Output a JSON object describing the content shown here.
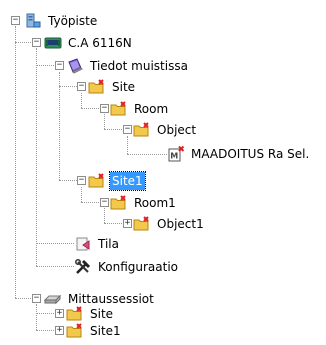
{
  "tree": {
    "root": {
      "label": "Työpiste",
      "icon": "computer-icon",
      "expanded": true
    },
    "instrument": {
      "label": "C.A 6116N",
      "icon": "instrument-icon",
      "expanded": true
    },
    "memory": {
      "label": "Tiedot muistissa",
      "icon": "memory-book-icon",
      "expanded": true
    },
    "mem_site": {
      "label": "Site",
      "icon": "folder-error-icon",
      "expanded": true
    },
    "mem_room": {
      "label": "Room",
      "icon": "folder-error-icon",
      "expanded": true
    },
    "mem_object": {
      "label": "Object",
      "icon": "folder-error-icon",
      "expanded": true
    },
    "mem_measurement": {
      "label": "MAADOITUS Ra Sel.",
      "icon": "measurement-error-icon"
    },
    "mem_site1": {
      "label": "Site1",
      "icon": "folder-error-icon",
      "expanded": true,
      "selected": true
    },
    "mem_room1": {
      "label": "Room1",
      "icon": "folder-error-icon",
      "expanded": true
    },
    "mem_object1": {
      "label": "Object1",
      "icon": "folder-error-icon",
      "expanded": false
    },
    "status": {
      "label": "Tila",
      "icon": "status-page-icon"
    },
    "configuration": {
      "label": "Konfiguraatio",
      "icon": "tools-icon"
    },
    "sessions": {
      "label": "Mittaussessiot",
      "icon": "disk-icon",
      "expanded": true
    },
    "sess_site": {
      "label": "Site",
      "icon": "folder-error-icon",
      "expanded": false
    },
    "sess_site1": {
      "label": "Site1",
      "icon": "folder-error-icon",
      "expanded": false
    }
  },
  "colors": {
    "selection": "#3399ff",
    "folder": "#f2c94c",
    "error_mark": "#e02020",
    "guide_lines": "#9a9a9a"
  }
}
